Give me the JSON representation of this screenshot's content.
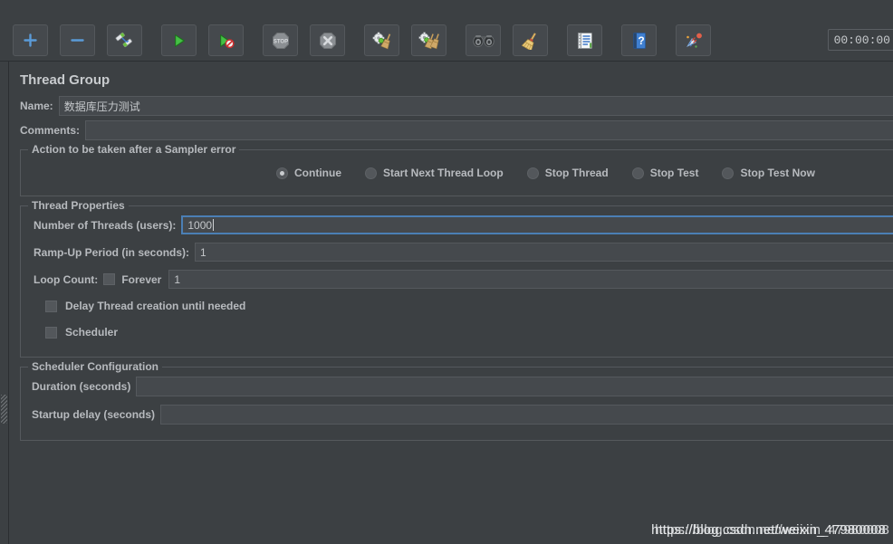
{
  "toolbar": {
    "buttons": [
      {
        "name": "new-button",
        "icon": "plus-icon",
        "label": "+"
      },
      {
        "name": "templates-button",
        "icon": "minus-icon",
        "label": "−"
      },
      {
        "name": "toggle-button",
        "icon": "toggle-icon",
        "label": ""
      },
      {
        "name": "start-button",
        "icon": "play-icon",
        "label": ""
      },
      {
        "name": "start-no-pauses-button",
        "icon": "play-no-pauses-icon",
        "label": ""
      },
      {
        "name": "stop-button",
        "icon": "stop-icon",
        "label": "STOP"
      },
      {
        "name": "shutdown-button",
        "icon": "shutdown-x-icon",
        "label": ""
      },
      {
        "name": "clear-button",
        "icon": "clear-gear-broom-icon",
        "label": ""
      },
      {
        "name": "clear-all-button",
        "icon": "clear-all-broom-icon",
        "label": ""
      },
      {
        "name": "search-button",
        "icon": "binoculars-icon",
        "label": ""
      },
      {
        "name": "reset-search-button",
        "icon": "broom-icon",
        "label": ""
      },
      {
        "name": "function-helper-button",
        "icon": "notepad-list-icon",
        "label": ""
      },
      {
        "name": "help-button",
        "icon": "help-book-icon",
        "label": "?"
      },
      {
        "name": "undo-redo-button",
        "icon": "confetti-icon",
        "label": ""
      }
    ],
    "timer": "00:00:00"
  },
  "panel": {
    "title": "Thread Group",
    "name_label": "Name:",
    "name_value": "数据库压力测试",
    "comments_label": "Comments:",
    "comments_value": ""
  },
  "sampler_error": {
    "group_title": "Action to be taken after a Sampler error",
    "options": [
      {
        "label": "Continue",
        "selected": true
      },
      {
        "label": "Start Next Thread Loop",
        "selected": false
      },
      {
        "label": "Stop Thread",
        "selected": false
      },
      {
        "label": "Stop Test",
        "selected": false
      },
      {
        "label": "Stop Test Now",
        "selected": false
      }
    ]
  },
  "thread_properties": {
    "group_title": "Thread Properties",
    "num_threads_label": "Number of Threads (users):",
    "num_threads_value": "1000",
    "num_threads_focused": true,
    "ramp_up_label": "Ramp-Up Period (in seconds):",
    "ramp_up_value": "1",
    "loop_count_label": "Loop Count:",
    "forever_label": "Forever",
    "forever_checked": false,
    "loop_count_value": "1",
    "delay_thread_label": "Delay Thread creation until needed",
    "delay_thread_checked": false,
    "scheduler_label": "Scheduler",
    "scheduler_checked": false
  },
  "scheduler_config": {
    "group_title": "Scheduler Configuration",
    "duration_label": "Duration (seconds)",
    "duration_value": "",
    "startup_delay_label": "Startup delay (seconds)",
    "startup_delay_value": ""
  },
  "watermark": {
    "text": "https://blog.csdn.net/weixin_47980008"
  },
  "colors": {
    "window_bg": "#3c4043",
    "field_bg": "#45494d",
    "border": "#55595d",
    "text": "#b7babe",
    "focus_border": "#4b7fb5",
    "accent_blue": "#4b7fb5"
  }
}
